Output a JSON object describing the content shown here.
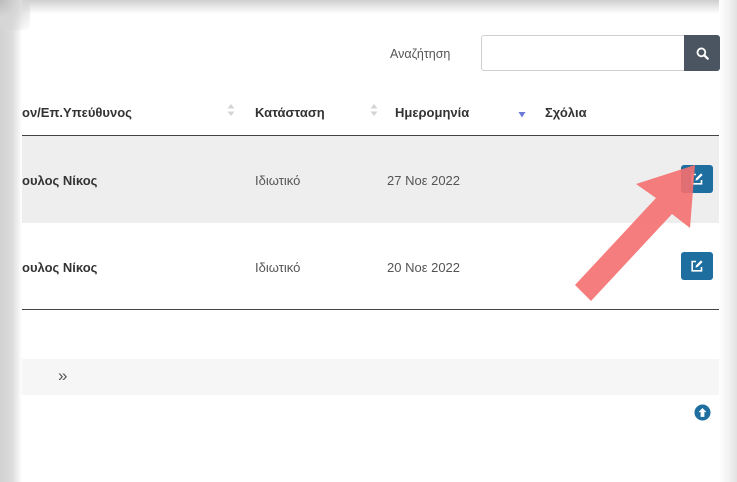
{
  "search": {
    "label": "Αναζήτηση",
    "value": "",
    "placeholder": "",
    "button_icon": "search-icon"
  },
  "table": {
    "columns": [
      "ον/Επ.Υπεύθυνος",
      "Κατάσταση",
      "Ημερομηνία",
      "Σχόλια"
    ],
    "sorted_column": "Ημερομηνία",
    "sort_direction": "descending",
    "rows": [
      {
        "name": "ουλος Νίκος",
        "status": "Ιδιωτικό",
        "date": "27 Νοε 2022",
        "comments": "",
        "action_icon": "edit-icon"
      },
      {
        "name": "ουλος Νίκος",
        "status": "Ιδιωτικό",
        "date": "20 Νοε 2022",
        "comments": "",
        "action_icon": "edit-icon"
      }
    ]
  },
  "pagination": {
    "next_label": "»"
  },
  "scroll_top_icon": "arrow-up-circle-icon",
  "colors": {
    "accent": "#1f6ea0",
    "search_button": "#4b5561",
    "row_highlight": "#eeeeee",
    "annotation_arrow": "#f56f6f"
  }
}
